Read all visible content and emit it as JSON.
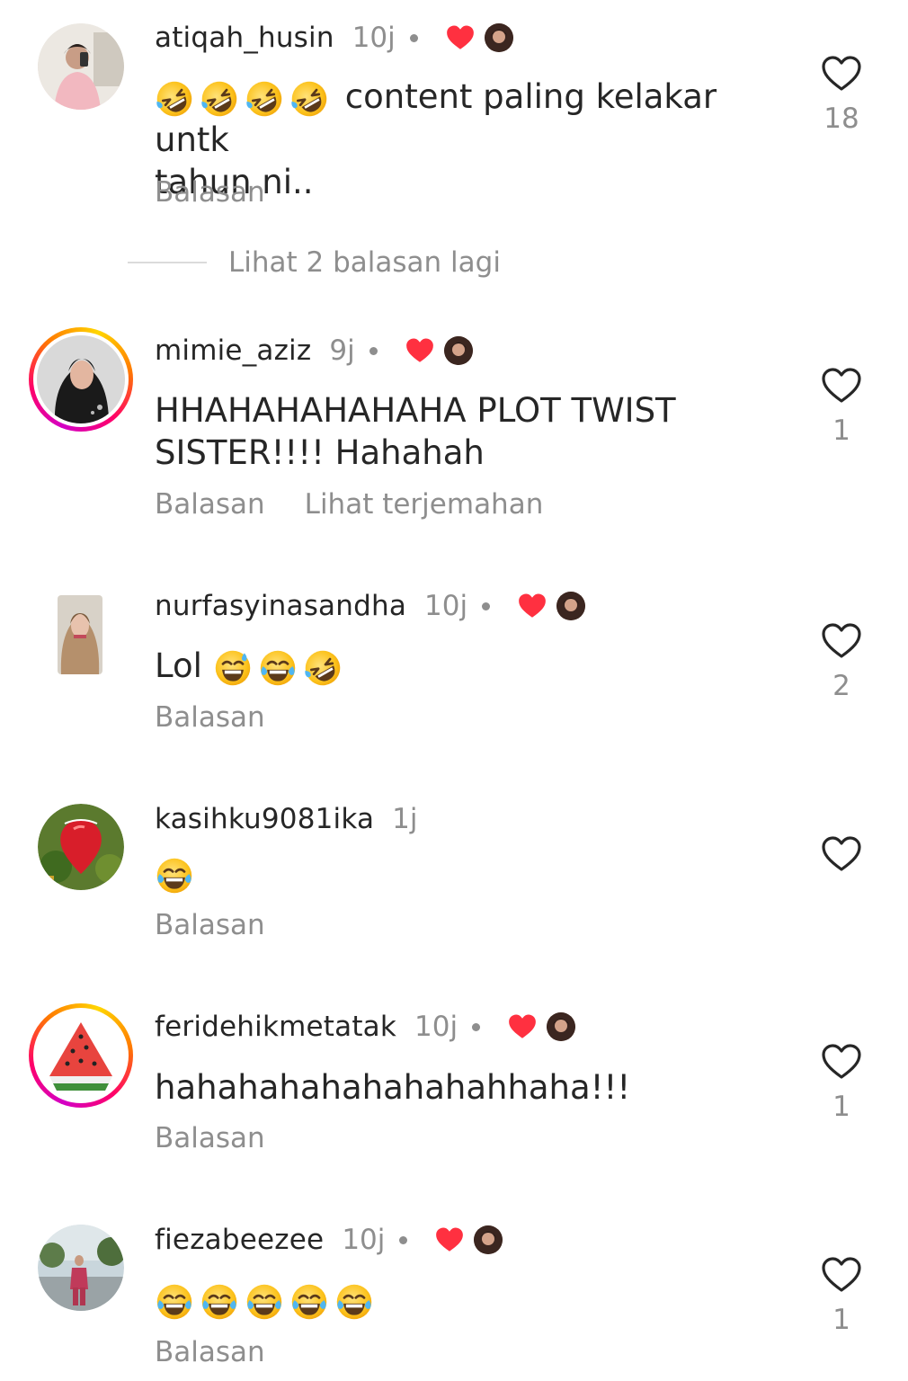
{
  "view_replies_label": "Lihat 2 balasan lagi",
  "colors": {
    "text": "#262626",
    "secondary": "#8e8e8e",
    "heart": "#ff3040"
  },
  "comments": [
    {
      "username": "atiqah_husin",
      "time": "10j",
      "creator_liked": true,
      "text_after_emoji": "content paling kelakar untk\ntahun ni..",
      "emojis": [
        "rolling-on-floor-laughing",
        "rolling-on-floor-laughing",
        "rolling-on-floor-laughing",
        "rolling-on-floor-laughing"
      ],
      "reply_label": "Balasan",
      "likes": "18"
    },
    {
      "username": "mimie_aziz",
      "time": "9j",
      "creator_liked": true,
      "text": "HHAHAHAHAHAHA PLOT TWIST\nSISTER!!!! Hahahah",
      "reply_label": "Balasan",
      "translate_label": "Lihat terjemahan",
      "likes": "1"
    },
    {
      "username": "nurfasyinasandha",
      "time": "10j",
      "creator_liked": true,
      "text": "Lol",
      "emojis": [
        "grinning-sweat",
        "tears-of-joy",
        "rolling-on-floor-laughing"
      ],
      "reply_label": "Balasan",
      "likes": "2"
    },
    {
      "username": "kasihku9081ika",
      "time": "1j",
      "creator_liked": false,
      "emojis": [
        "tears-of-joy"
      ],
      "reply_label": "Balasan",
      "likes": ""
    },
    {
      "username": "feridehikmetatak",
      "time": "10j",
      "creator_liked": true,
      "text": "hahahahahahahahahhaha!!!",
      "reply_label": "Balasan",
      "likes": "1"
    },
    {
      "username": "fiezabeezee",
      "time": "10j",
      "creator_liked": true,
      "emojis": [
        "tears-of-joy",
        "tears-of-joy",
        "tears-of-joy",
        "tears-of-joy",
        "tears-of-joy"
      ],
      "reply_label": "Balasan",
      "likes": "1"
    }
  ]
}
